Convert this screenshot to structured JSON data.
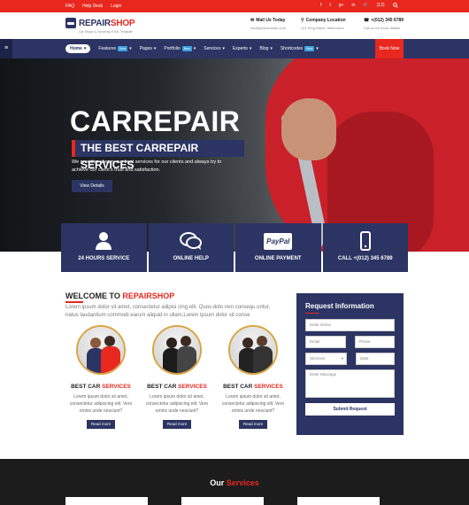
{
  "topbar": {
    "links": [
      "FAQ",
      "Help Desk",
      "Login"
    ],
    "social": [
      "f",
      "t",
      "g+",
      "in",
      "🛒",
      "(12)",
      "search"
    ]
  },
  "header": {
    "logo_main": "REPAIR",
    "logo_accent": "SHOP",
    "tagline": "Car Repair & Servicing HTML Template",
    "mail_title": "Mail Us Today",
    "mail_sub": "info@yourdomain.com",
    "location_title": "Company Location",
    "location_sub": "121 King Street, Melbourne",
    "phone_title": "+(012) 345 6789",
    "phone_sub": "Call us for more details"
  },
  "nav": {
    "items": [
      "Home",
      "Features",
      "Pages",
      "Portfolio",
      "Services",
      "Experts",
      "Blog",
      "Shortcodes"
    ],
    "new_badge": "New",
    "book_now": "Book Now"
  },
  "hero": {
    "title": "CARREPAIR",
    "subtitle": "THE BEST CARREPAIR SERVICES",
    "text": "We provides always our best services for our clients and always try to achieve our client's trust and satisfaction.",
    "button": "View Details"
  },
  "features": [
    "24 HOURS SERVICE",
    "ONLINE HELP",
    "ONLINE PAYMENT",
    "CALL +(012) 345 6789"
  ],
  "features_paypal": "PayPal",
  "welcome": {
    "title_prefix": "WELCOME TO",
    "title_accent": "REPAIRSHOP",
    "text": "Lorem ipsum dolor sit amet, consectetur adipisi cing elit. Quos dolo rem consequ untur, natus laudantium commodi earum aliquid in ullam.Lorem ipsum dolor sit conse",
    "cards": [
      {
        "title": "BEST CAR",
        "accent": "SERVICES",
        "text": "Lorem ipsum dolor sit amet, consectetur adipiscing elit. Vero omnis unde nesciunt?",
        "button": "Read more"
      },
      {
        "title": "BEST CAR",
        "accent": "SERVICES",
        "text": "Lorem ipsum dolor sit amet, consectetur adipiscing elit. Vero omnis unde nesciunt?",
        "button": "Read more"
      },
      {
        "title": "BEST CAR",
        "accent": "SERVICES",
        "text": "Lorem ipsum dolor sit amet, consectetur adipiscing elit. Vero omnis unde nesciunt?",
        "button": "Read more"
      }
    ]
  },
  "request": {
    "title": "Request Information",
    "name_ph": "Enter Name",
    "email_ph": "Email",
    "phone_ph": "Phone",
    "services_value": "Services",
    "date_ph": "Date",
    "message_ph": "Enter Message",
    "submit": "Submit Request"
  },
  "our_services": {
    "prefix": "Our",
    "accent": "Services"
  },
  "colors": {
    "accent": "#e8281e",
    "navy": "#2b3462",
    "dark": "#1c1c1c"
  }
}
